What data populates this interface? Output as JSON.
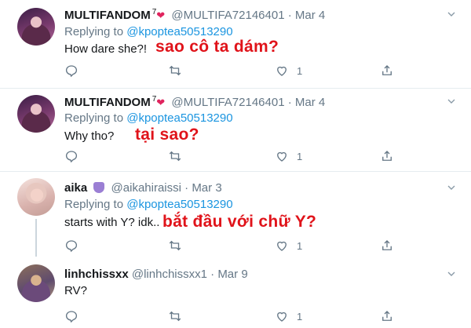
{
  "tweets": [
    {
      "name": "MULTIFANDOM",
      "sup": "7",
      "heart": "❤",
      "handle": "@MULTIFA72146401",
      "dot": "·",
      "date": "Mar 4",
      "replying_prefix": "Replying to ",
      "replying_to": "@kpoptea50513290",
      "text": "How dare she?!",
      "overlay": "sao cô ta dám?",
      "like_count": "1"
    },
    {
      "name": "MULTIFANDOM",
      "sup": "7",
      "heart": "❤",
      "handle": "@MULTIFA72146401",
      "dot": "·",
      "date": "Mar 4",
      "replying_prefix": "Replying to ",
      "replying_to": "@kpoptea50513290",
      "text": "Why tho?",
      "overlay": "tại sao?",
      "like_count": "1"
    },
    {
      "name": "aika",
      "handle": "@aikahiraissi",
      "dot": "·",
      "date": "Mar 3",
      "replying_prefix": "Replying to ",
      "replying_to": "@kpoptea50513290",
      "text": "starts with Y? idk..",
      "overlay": "bắt đầu với chữ Y?",
      "like_count": "1"
    },
    {
      "name": "linhchissxx",
      "handle": "@linhchissxx1",
      "dot": "·",
      "date": "Mar 9",
      "text": "RV?",
      "like_count": "1"
    }
  ],
  "icons": {
    "caret": "chevron-down-icon",
    "reply": "reply-icon",
    "retweet": "retweet-icon",
    "like": "heart-icon",
    "share": "share-icon"
  },
  "colors": {
    "mention": "#1b95e0",
    "overlay_text": "#e0131a",
    "muted": "#657786"
  }
}
